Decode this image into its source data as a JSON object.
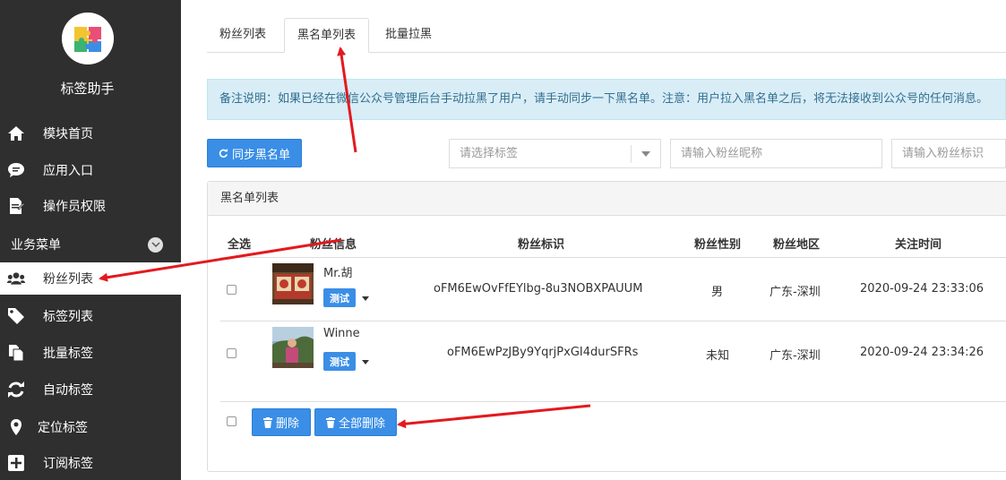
{
  "app": {
    "title": "标签助手"
  },
  "sidebar": {
    "items": [
      {
        "label": "模块首页",
        "icon": "home-icon"
      },
      {
        "label": "应用入口",
        "icon": "chat-icon"
      },
      {
        "label": "操作员权限",
        "icon": "document-edit-icon"
      }
    ],
    "section_label": "业务菜单",
    "business_items": [
      {
        "label": "粉丝列表",
        "icon": "users-icon"
      },
      {
        "label": "标签列表",
        "icon": "tag-icon"
      },
      {
        "label": "批量标签",
        "icon": "copy-icon"
      },
      {
        "label": "自动标签",
        "icon": "refresh-icon"
      },
      {
        "label": "定位标签",
        "icon": "map-marker-icon"
      },
      {
        "label": "订阅标签",
        "icon": "plus-square-icon"
      }
    ]
  },
  "tabs": [
    {
      "label": "粉丝列表"
    },
    {
      "label": "黑名单列表"
    },
    {
      "label": "批量拉黑"
    }
  ],
  "notice": "备注说明：如果已经在微信公众号管理后台手动拉黑了用户，请手动同步一下黑名单。注意：用户拉入黑名单之后，将无法接收到公众号的任何消息。",
  "toolbar": {
    "sync_label": "同步黑名单",
    "tag_select_placeholder": "请选择标签",
    "nickname_placeholder": "请输入粉丝昵称",
    "fan_id_placeholder": "请输入粉丝标识"
  },
  "panel": {
    "title": "黑名单列表",
    "columns": [
      "全选",
      "粉丝信息",
      "粉丝标识",
      "粉丝性别",
      "粉丝地区",
      "关注时间"
    ],
    "rows": [
      {
        "name": "Mr.胡",
        "tag": "测试",
        "fan_id": "oFM6EwOvFfEYlbg-8u3NOBXPAUUM",
        "gender": "男",
        "region": "广东-深圳",
        "follow_time": "2020-09-24 23:33:06"
      },
      {
        "name": "Winne",
        "tag": "测试",
        "fan_id": "oFM6EwPzJBy9YqrjPxGI4durSFRs",
        "gender": "未知",
        "region": "广东-深圳",
        "follow_time": "2020-09-24 23:34:26"
      }
    ],
    "delete_label": "删除",
    "delete_all_label": "全部删除"
  },
  "colors": {
    "sidebar_bg": "#2f2f2f",
    "primary": "#3a8ee6",
    "notice_bg": "#d9edf7",
    "arrow": "#e3191e"
  }
}
